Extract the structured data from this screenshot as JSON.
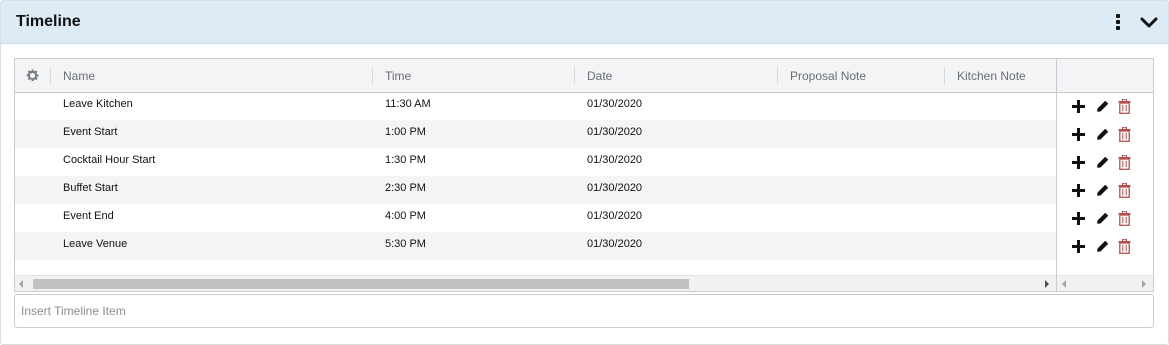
{
  "panel": {
    "title": "Timeline"
  },
  "grid": {
    "columns": [
      "Name",
      "Time",
      "Date",
      "Proposal Note",
      "Kitchen Note"
    ],
    "rows": [
      {
        "name": "Leave Kitchen",
        "time": "11:30 AM",
        "date": "01/30/2020",
        "proposal_note": "",
        "kitchen_note": ""
      },
      {
        "name": "Event Start",
        "time": "1:00 PM",
        "date": "01/30/2020",
        "proposal_note": "",
        "kitchen_note": ""
      },
      {
        "name": "Cocktail Hour Start",
        "time": "1:30 PM",
        "date": "01/30/2020",
        "proposal_note": "",
        "kitchen_note": ""
      },
      {
        "name": "Buffet Start",
        "time": "2:30 PM",
        "date": "01/30/2020",
        "proposal_note": "",
        "kitchen_note": ""
      },
      {
        "name": "Event End",
        "time": "4:00 PM",
        "date": "01/30/2020",
        "proposal_note": "",
        "kitchen_note": ""
      },
      {
        "name": "Leave Venue",
        "time": "5:30 PM",
        "date": "01/30/2020",
        "proposal_note": "",
        "kitchen_note": ""
      }
    ],
    "row_actions": [
      "plus-icon",
      "pencil-icon",
      "trash-icon"
    ]
  },
  "insert": {
    "placeholder": "Insert Timeline Item",
    "value": ""
  },
  "colors": {
    "header_bg": "#dcebf5",
    "row_alt_bg": "#f3f4f6",
    "trash": "#b5504f"
  }
}
